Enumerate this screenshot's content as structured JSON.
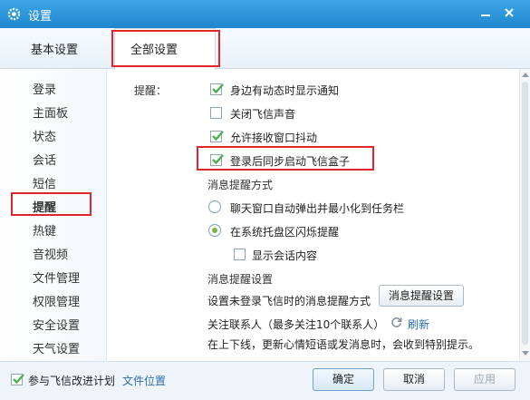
{
  "window": {
    "title": "设置"
  },
  "tabs": {
    "basic": "基本设置",
    "all": "全部设置"
  },
  "sidebar": {
    "items": [
      "登录",
      "主面板",
      "状态",
      "会话",
      "短信",
      "提醒",
      "热键",
      "音视频",
      "文件管理",
      "权限管理",
      "安全设置",
      "天气设置"
    ],
    "selected": "提醒"
  },
  "content": {
    "reminder_label": "提醒：",
    "options": [
      {
        "label": "身边有动态时显示通知",
        "checked": true
      },
      {
        "label": "关闭飞信声音",
        "checked": false
      },
      {
        "label": "允许接收窗口抖动",
        "checked": true
      },
      {
        "label": "登录后同步启动飞信盒子",
        "checked": true
      }
    ],
    "notify_mode": {
      "heading": "消息提醒方式",
      "radio_popup": "聊天窗口自动弹出并最小化到任务栏",
      "radio_tray": "在系统托盘区闪烁提醒",
      "selected": "tray",
      "show_content": "显示会话内容",
      "show_content_checked": false
    },
    "notify_settings": {
      "heading": "消息提醒设置",
      "desc": "设置未登录飞信时的消息提醒方式",
      "button": "消息提醒设置"
    },
    "follow": {
      "label": "关注联系人（最多关注10个联系人）",
      "refresh": "刷新",
      "note": "在上下线，更新心情短语或发消息时，会收到特别提示。"
    }
  },
  "footer": {
    "join_plan": "参与飞信改进计划",
    "join_checked": true,
    "file_location": "文件位置",
    "ok": "确定",
    "cancel": "取消",
    "apply": "应用"
  },
  "colors": {
    "titlebar": "#1f86cf",
    "highlight": "#e0262a",
    "check": "#4caf50"
  }
}
